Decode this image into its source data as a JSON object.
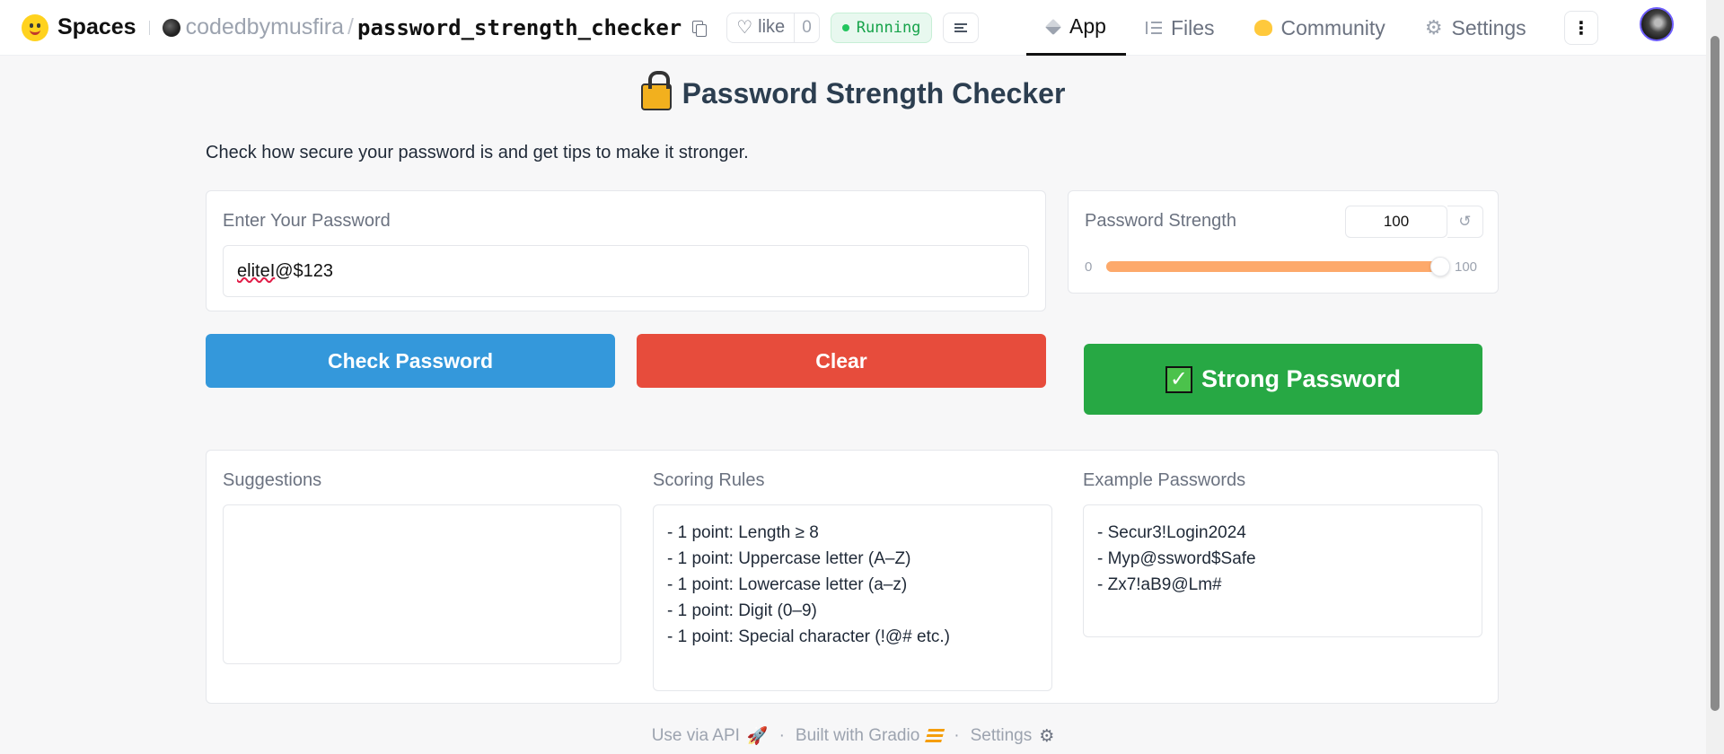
{
  "nav": {
    "brand": "Spaces",
    "owner": "codedbymusfira",
    "repo": "password_strength_checker",
    "like_label": "like",
    "like_count": "0",
    "status": "Running",
    "tabs": [
      {
        "label": "App",
        "icon": "cube-icon",
        "active": true
      },
      {
        "label": "Files",
        "icon": "files-icon",
        "active": false
      },
      {
        "label": "Community",
        "icon": "community-icon",
        "active": false
      },
      {
        "label": "Settings",
        "icon": "gear-icon",
        "active": false
      }
    ]
  },
  "app": {
    "title": "Password Strength Checker",
    "subtitle": "Check how secure your password is and get tips to make it stronger.",
    "password_label": "Enter Your Password",
    "password_value_part1": "eliteI",
    "password_value_part2": "@$123",
    "strength_label": "Password Strength",
    "strength_value": "100",
    "slider_min": "0",
    "slider_max": "100",
    "slider_fraction": 1.0,
    "check_button": "Check Password",
    "clear_button": "Clear",
    "result": "Strong Password",
    "suggestions_label": "Suggestions",
    "suggestions": "",
    "rules_label": "Scoring Rules",
    "rules": [
      "- 1 point: Length ≥ 8",
      "- 1 point: Uppercase letter (A–Z)",
      "- 1 point: Lowercase letter (a–z)",
      "- 1 point: Digit (0–9)",
      "- 1 point: Special character (!@# etc.)"
    ],
    "examples_label": "Example Passwords",
    "examples": [
      "- Secur3!Login2024",
      "- Myp@ssword$Safe",
      "- Zx7!aB9@Lm#"
    ]
  },
  "footer": {
    "api": "Use via API",
    "built": "Built with Gradio",
    "settings": "Settings"
  },
  "colors": {
    "check_button": "#3498db",
    "clear_button": "#e74c3c",
    "strong_result": "#27a844",
    "slider_fill": "#fda96b",
    "title": "#2c3e50"
  }
}
